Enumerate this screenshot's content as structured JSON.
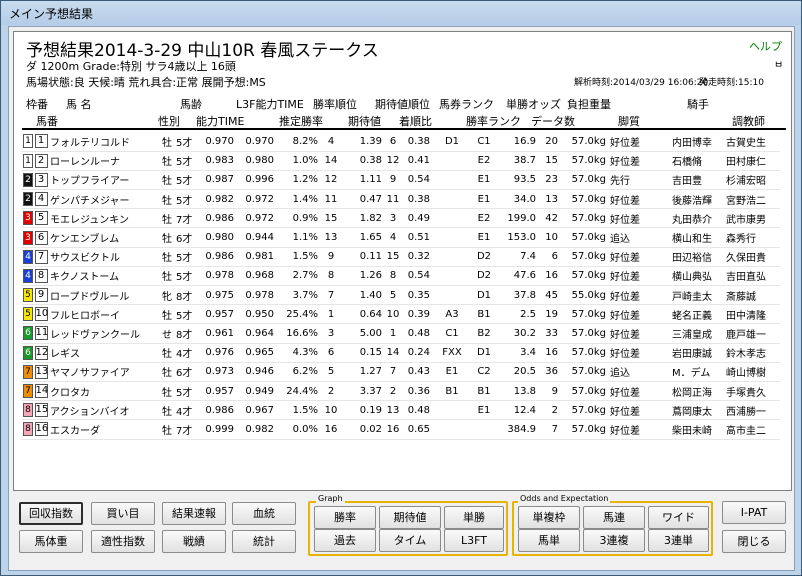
{
  "window": {
    "title": "メイン予想結果"
  },
  "header": {
    "race_title": "予想結果2014-3-29 中山10R 春風ステークス",
    "help": "ヘルプ",
    "pin": "ㅂ",
    "race_info": "ダ 1200m  Grade:特別 サラ4歳以上 16頭",
    "conditions": "馬場状態:良   天候:晴   荒れ具合:正常   展開予想:MS",
    "analysis_time": "解析時刻:2014/03/29 16:06:20",
    "start_time": "発走時刻:15:10"
  },
  "columns_row1": [
    "枠番",
    "馬 名",
    "馬齢",
    "L3F能力TIME",
    "勝率順位",
    "期待値順位",
    "馬券ランク",
    "単勝オッズ",
    "負担重量",
    "騎手"
  ],
  "columns_row2": [
    "馬番",
    "性別",
    "能力TIME",
    "推定勝率",
    "期待値",
    "着順比",
    "勝率ランク",
    "データ数",
    "脚質",
    "調教師"
  ],
  "rows": [
    {
      "waku": "1",
      "num": "1",
      "name": "フォルテリコルド",
      "sex": "牡",
      "age": "5才",
      "ability": "0.970",
      "l3f": "0.970",
      "rate": "8.2%",
      "rank": "4",
      "exp": "1.39",
      "exp_rank": "6",
      "finish": "0.38",
      "bet_rank": "D1",
      "win_rank": "C1",
      "odds": "16.9",
      "data": "20",
      "weight": "57.0kg",
      "style": "好位差",
      "jockey": "内田博幸",
      "trainer": "古賀史生"
    },
    {
      "waku": "1",
      "num": "2",
      "name": "ローレンルーナ",
      "sex": "牡",
      "age": "5才",
      "ability": "0.983",
      "l3f": "0.980",
      "rate": "1.0%",
      "rank": "14",
      "exp": "0.38",
      "exp_rank": "12",
      "finish": "0.41",
      "bet_rank": "",
      "win_rank": "E2",
      "odds": "38.7",
      "data": "15",
      "weight": "57.0kg",
      "style": "好位差",
      "jockey": "石橋脩",
      "trainer": "田村康仁"
    },
    {
      "waku": "2",
      "num": "3",
      "name": "トップフライアー",
      "sex": "牡",
      "age": "5才",
      "ability": "0.987",
      "l3f": "0.996",
      "rate": "1.2%",
      "rank": "12",
      "exp": "1.11",
      "exp_rank": "9",
      "finish": "0.54",
      "bet_rank": "",
      "win_rank": "E1",
      "odds": "93.5",
      "data": "23",
      "weight": "57.0kg",
      "style": "先行",
      "jockey": "吉田豊",
      "trainer": "杉浦宏昭"
    },
    {
      "waku": "2",
      "num": "4",
      "name": "ゲンパチメジャー",
      "sex": "牡",
      "age": "5才",
      "ability": "0.982",
      "l3f": "0.972",
      "rate": "1.4%",
      "rank": "11",
      "exp": "0.47",
      "exp_rank": "11",
      "finish": "0.38",
      "bet_rank": "",
      "win_rank": "E1",
      "odds": "34.0",
      "data": "13",
      "weight": "57.0kg",
      "style": "好位差",
      "jockey": "後藤浩輝",
      "trainer": "宮野浩二"
    },
    {
      "waku": "3",
      "num": "5",
      "name": "モエレジュンキン",
      "sex": "牡",
      "age": "7才",
      "ability": "0.986",
      "l3f": "0.972",
      "rate": "0.9%",
      "rank": "15",
      "exp": "1.82",
      "exp_rank": "3",
      "finish": "0.49",
      "bet_rank": "",
      "win_rank": "E2",
      "odds": "199.0",
      "data": "42",
      "weight": "57.0kg",
      "style": "好位差",
      "jockey": "丸田恭介",
      "trainer": "武市康男"
    },
    {
      "waku": "3",
      "num": "6",
      "name": "ケンエンブレム",
      "sex": "牡",
      "age": "6才",
      "ability": "0.980",
      "l3f": "0.944",
      "rate": "1.1%",
      "rank": "13",
      "exp": "1.65",
      "exp_rank": "4",
      "finish": "0.51",
      "bet_rank": "",
      "win_rank": "E1",
      "odds": "153.0",
      "data": "10",
      "weight": "57.0kg",
      "style": "追込",
      "jockey": "横山和生",
      "trainer": "森秀行"
    },
    {
      "waku": "4",
      "num": "7",
      "name": "サウスビクトル",
      "sex": "牡",
      "age": "5才",
      "ability": "0.986",
      "l3f": "0.981",
      "rate": "1.5%",
      "rank": "9",
      "exp": "0.11",
      "exp_rank": "15",
      "finish": "0.32",
      "bet_rank": "",
      "win_rank": "D2",
      "odds": "7.4",
      "data": "6",
      "weight": "57.0kg",
      "style": "好位差",
      "jockey": "田辺裕信",
      "trainer": "久保田貴"
    },
    {
      "waku": "4",
      "num": "8",
      "name": "キクノストーム",
      "sex": "牡",
      "age": "5才",
      "ability": "0.978",
      "l3f": "0.968",
      "rate": "2.7%",
      "rank": "8",
      "exp": "1.26",
      "exp_rank": "8",
      "finish": "0.54",
      "bet_rank": "",
      "win_rank": "D2",
      "odds": "47.6",
      "data": "16",
      "weight": "57.0kg",
      "style": "好位差",
      "jockey": "横山典弘",
      "trainer": "吉田直弘"
    },
    {
      "waku": "5",
      "num": "9",
      "name": "ロープドヴルール",
      "sex": "牝",
      "age": "8才",
      "ability": "0.975",
      "l3f": "0.978",
      "rate": "3.7%",
      "rank": "7",
      "exp": "1.40",
      "exp_rank": "5",
      "finish": "0.35",
      "bet_rank": "",
      "win_rank": "D1",
      "odds": "37.8",
      "data": "45",
      "weight": "55.0kg",
      "style": "好位差",
      "jockey": "戸崎圭太",
      "trainer": "斎藤誠"
    },
    {
      "waku": "5",
      "num": "10",
      "name": "フルヒロボーイ",
      "sex": "牡",
      "age": "5才",
      "ability": "0.957",
      "l3f": "0.950",
      "rate": "25.4%",
      "rank": "1",
      "exp": "0.64",
      "exp_rank": "10",
      "finish": "0.39",
      "bet_rank": "A3",
      "win_rank": "B1",
      "odds": "2.5",
      "data": "19",
      "weight": "57.0kg",
      "style": "好位差",
      "jockey": "蛯名正義",
      "trainer": "田中清隆"
    },
    {
      "waku": "6",
      "num": "11",
      "name": "レッドヴァンクール",
      "sex": "せ",
      "age": "8才",
      "ability": "0.961",
      "l3f": "0.964",
      "rate": "16.6%",
      "rank": "3",
      "exp": "5.00",
      "exp_rank": "1",
      "finish": "0.48",
      "bet_rank": "C1",
      "win_rank": "B2",
      "odds": "30.2",
      "data": "33",
      "weight": "57.0kg",
      "style": "好位差",
      "jockey": "三浦皇成",
      "trainer": "鹿戸雄一"
    },
    {
      "waku": "6",
      "num": "12",
      "name": "レギス",
      "sex": "牡",
      "age": "4才",
      "ability": "0.976",
      "l3f": "0.965",
      "rate": "4.3%",
      "rank": "6",
      "exp": "0.15",
      "exp_rank": "14",
      "finish": "0.24",
      "bet_rank": "FXX",
      "win_rank": "D1",
      "odds": "3.4",
      "data": "16",
      "weight": "57.0kg",
      "style": "好位差",
      "jockey": "岩田康誠",
      "trainer": "鈴木孝志"
    },
    {
      "waku": "7",
      "num": "13",
      "name": "ヤマノサファイア",
      "sex": "牡",
      "age": "6才",
      "ability": "0.973",
      "l3f": "0.946",
      "rate": "6.2%",
      "rank": "5",
      "exp": "1.27",
      "exp_rank": "7",
      "finish": "0.43",
      "bet_rank": "E1",
      "win_rank": "C2",
      "odds": "20.5",
      "data": "36",
      "weight": "57.0kg",
      "style": "追込",
      "jockey": "M．デム",
      "trainer": "崎山博樹"
    },
    {
      "waku": "7",
      "num": "14",
      "name": "クロタカ",
      "sex": "牡",
      "age": "5才",
      "ability": "0.957",
      "l3f": "0.949",
      "rate": "24.4%",
      "rank": "2",
      "exp": "3.37",
      "exp_rank": "2",
      "finish": "0.36",
      "bet_rank": "B1",
      "win_rank": "B1",
      "odds": "13.8",
      "data": "9",
      "weight": "57.0kg",
      "style": "好位差",
      "jockey": "松岡正海",
      "trainer": "手塚貴久"
    },
    {
      "waku": "8",
      "num": "15",
      "name": "アクションバイオ",
      "sex": "牡",
      "age": "4才",
      "ability": "0.986",
      "l3f": "0.967",
      "rate": "1.5%",
      "rank": "10",
      "exp": "0.19",
      "exp_rank": "13",
      "finish": "0.48",
      "bet_rank": "",
      "win_rank": "E1",
      "odds": "12.4",
      "data": "2",
      "weight": "57.0kg",
      "style": "好位差",
      "jockey": "蔦岡康太",
      "trainer": "西浦勝一"
    },
    {
      "waku": "8",
      "num": "16",
      "name": "エスカーダ",
      "sex": "牡",
      "age": "7才",
      "ability": "0.999",
      "l3f": "0.982",
      "rate": "0.0%",
      "rank": "16",
      "exp": "0.02",
      "exp_rank": "16",
      "finish": "0.65",
      "bet_rank": "",
      "win_rank": "",
      "odds": "384.9",
      "data": "7",
      "weight": "57.0kg",
      "style": "好位差",
      "jockey": "柴田未崎",
      "trainer": "高市圭二"
    }
  ],
  "waku_colors": {
    "1": "#ffffff",
    "2": "#111111",
    "3": "#e00000",
    "4": "#1a3fd6",
    "5": "#f5e600",
    "6": "#1a9a2a",
    "7": "#f08c00",
    "8": "#f4a6b8"
  },
  "buttons_left": {
    "kaishu": "回収指数",
    "kaime": "買い目",
    "kekka": "結果速報",
    "ketto": "血統",
    "bataiju": "馬体重",
    "tekisei": "適性指数",
    "senseki": "戦績",
    "tokei": "統計"
  },
  "graph": {
    "label": "Graph",
    "shoritsu": "勝率",
    "kitaichi": "期待値",
    "tansho": "単勝",
    "kako": "過去",
    "time": "タイム",
    "l3ft": "L3FT"
  },
  "odds": {
    "label": "Odds and Expectation",
    "fukusho": "単複枠",
    "umaren": "馬連",
    "wide": "ワイド",
    "umatan": "馬単",
    "sanrenpuku": "3連複",
    "sanrentan": "3連単"
  },
  "buttons_right": {
    "ipat": "I-PAT",
    "close": "閉じる"
  }
}
